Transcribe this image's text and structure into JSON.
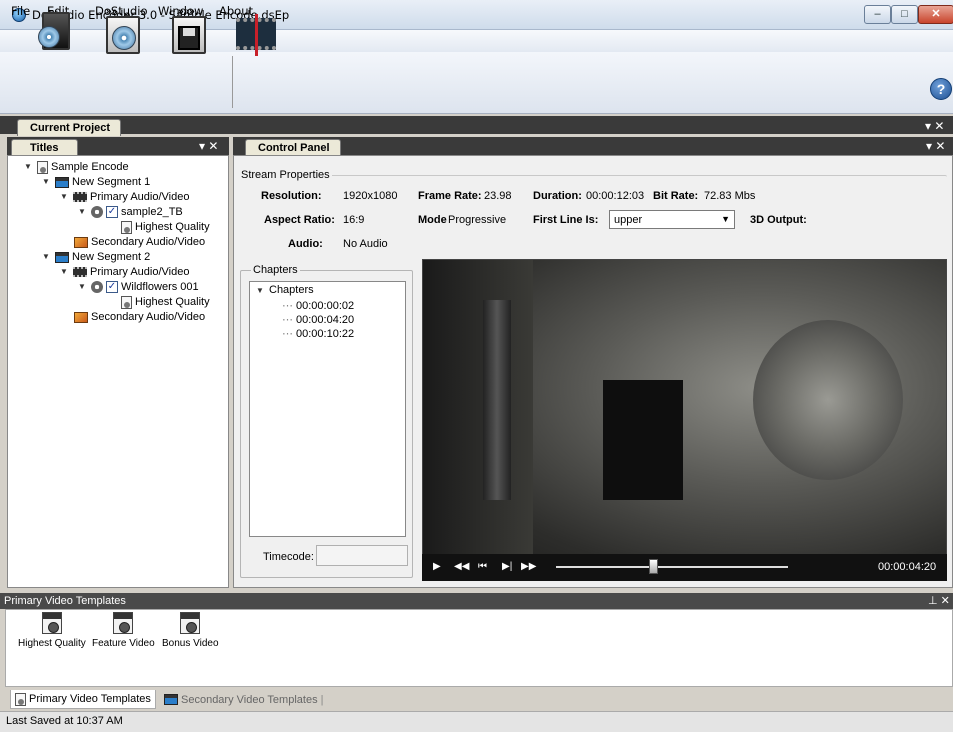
{
  "window": {
    "title": "DoStudio Encoder 3.0  - Sample Encode.dsEp",
    "min": "‒",
    "max": "□",
    "close": "✕"
  },
  "menu": [
    "File",
    "Edit",
    "DoStudio",
    "Window",
    "About"
  ],
  "toolbar": {
    "help": "?"
  },
  "project_tab": "Current Project",
  "titles_panel": {
    "tab": "Titles",
    "tree": [
      {
        "label": "Sample Encode"
      },
      {
        "label": "New Segment 1"
      },
      {
        "label": "Primary Audio/Video"
      },
      {
        "label": "sample2_TB",
        "checked": true
      },
      {
        "label": "Highest Quality"
      },
      {
        "label": "Secondary Audio/Video"
      },
      {
        "label": "New Segment 2"
      },
      {
        "label": "Primary Audio/Video"
      },
      {
        "label": "Wildflowers 001",
        "checked": true
      },
      {
        "label": "Highest Quality"
      },
      {
        "label": "Secondary Audio/Video"
      }
    ]
  },
  "control_panel": {
    "tab": "Control Panel",
    "stream_group": "Stream Properties",
    "resolution_label": "Resolution:",
    "resolution": "1920x1080",
    "frame_rate_label": "Frame Rate:",
    "frame_rate": "23.98",
    "duration_label": "Duration:",
    "duration": "00:00:12:03",
    "bit_rate_label": "Bit Rate:",
    "bit_rate": "72.83 Mbs",
    "aspect_label": "Aspect Ratio:",
    "aspect": "16:9",
    "mode_label": "Mode",
    "mode": "Progressive",
    "first_line_label": "First Line Is:",
    "first_line": "upper",
    "output_label": "3D Output:",
    "audio_label": "Audio:",
    "audio": "No Audio",
    "chapters_group": "Chapters",
    "chapters_root": "Chapters",
    "chapters": [
      "00:00:00:02",
      "00:00:04:20",
      "00:00:10:22"
    ],
    "timecode_label": "Timecode:",
    "timecode_value": "",
    "player": {
      "time": "00:00:04:20",
      "position": 0.42
    }
  },
  "templates": {
    "header": "Primary Video Templates",
    "items": [
      "Highest Quality",
      "Feature Video",
      "Bonus Video"
    ],
    "tabs": [
      "Primary Video Templates",
      "Secondary Video Templates"
    ]
  },
  "status": "Last Saved at 10:37 AM"
}
